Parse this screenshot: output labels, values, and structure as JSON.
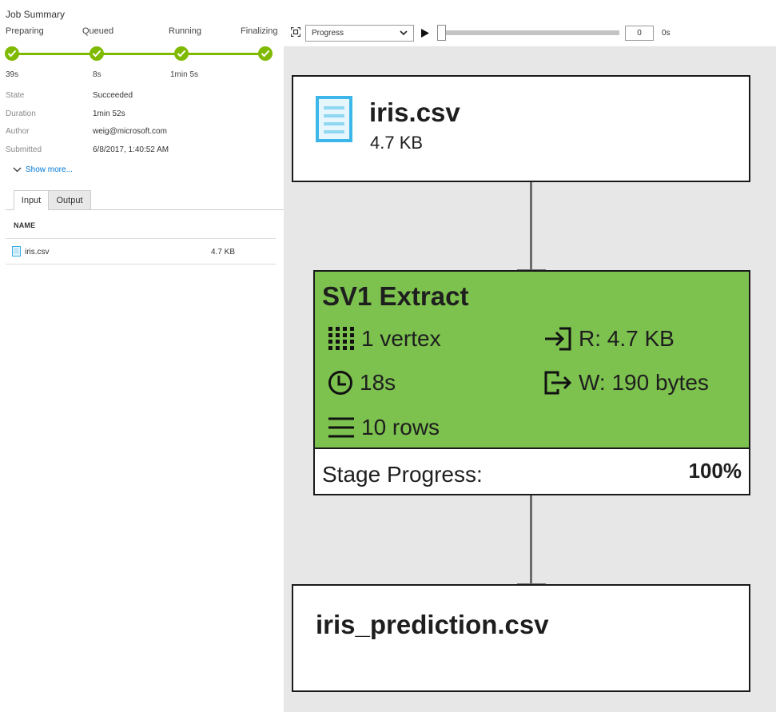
{
  "job_summary": {
    "title": "Job Summary",
    "steps": [
      {
        "label": "Preparing",
        "duration": "39s"
      },
      {
        "label": "Queued",
        "duration": "8s"
      },
      {
        "label": "Running",
        "duration": "1min 5s"
      },
      {
        "label": "Finalizing",
        "duration": ""
      }
    ],
    "info": [
      {
        "key": "State",
        "value": "Succeeded"
      },
      {
        "key": "Duration",
        "value": "1min 52s"
      },
      {
        "key": "Author",
        "value": "weig@microsoft.com"
      },
      {
        "key": "Submitted",
        "value": "6/8/2017, 1:40:52 AM"
      }
    ],
    "show_more": "Show more...",
    "tabs": [
      {
        "label": "Input",
        "active": true
      },
      {
        "label": "Output",
        "active": false
      }
    ],
    "table": {
      "column_name": "NAME",
      "rows": [
        {
          "name": "iris.csv",
          "size": "4.7 KB"
        }
      ]
    }
  },
  "toolbar": {
    "view_select": "Progress",
    "playback_value": "0",
    "playback_time": "0s",
    "slider_fraction": 0
  },
  "graph": {
    "input_node": {
      "name": "iris.csv",
      "size": "4.7 KB"
    },
    "stage_node": {
      "title": "SV1 Extract",
      "vertex": "1 vertex",
      "read": "R: 4.7 KB",
      "time": "18s",
      "write": "W: 190 bytes",
      "rows": "10 rows",
      "progress_label": "Stage Progress:",
      "progress_value": "100%",
      "status_color": "#7dc14f"
    },
    "output_node": {
      "name": "iris_prediction.csv"
    }
  },
  "colors": {
    "accent_green": "#7fba00",
    "link_blue": "#0078d7",
    "canvas_bg": "#e7e7e7"
  }
}
